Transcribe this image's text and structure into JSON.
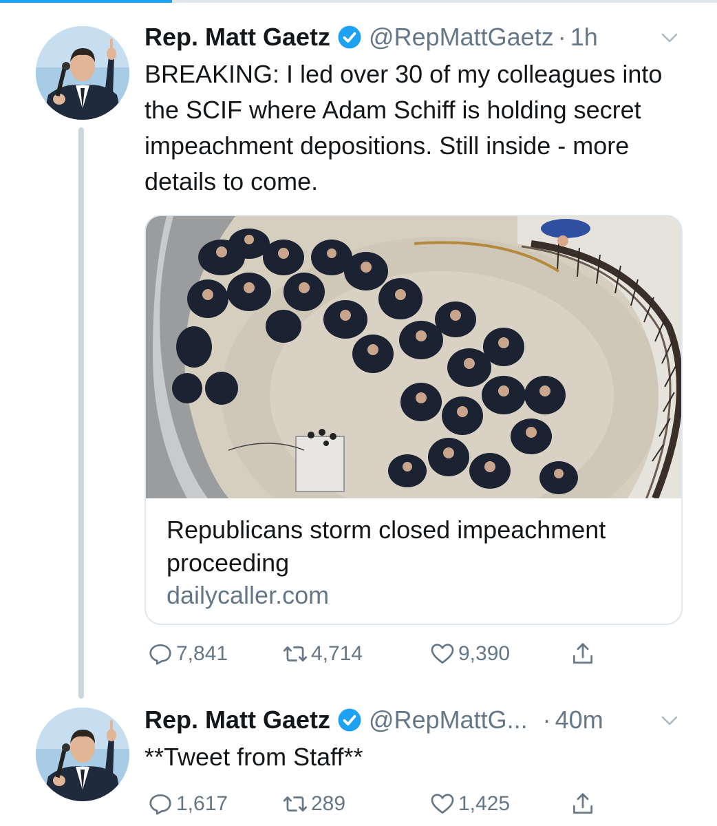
{
  "tweets": [
    {
      "name": "Rep. Matt Gaetz",
      "handle": "@RepMattGaetz",
      "separator": "·",
      "time": "1h",
      "text": "BREAKING: I led over 30 of my colleagues into the SCIF where Adam Schiff is holding secret impeachment depositions. Still inside - more details to come.",
      "card": {
        "title": "Republicans storm closed impeachment proceeding",
        "domain": "dailycaller.com"
      },
      "replies": "7,841",
      "retweets": "4,714",
      "likes": "9,390"
    },
    {
      "name": "Rep. Matt Gaetz",
      "handle": "@RepMattG...",
      "separator": "·",
      "time": "40m",
      "text": "**Tweet from Staff**",
      "replies": "1,617",
      "retweets": "289",
      "likes": "1,425"
    }
  ],
  "icons": {
    "verified": "verified-badge-icon",
    "menu": "chevron-down-icon",
    "reply": "reply-icon",
    "retweet": "retweet-icon",
    "like": "heart-icon",
    "share": "share-icon"
  },
  "colors": {
    "accent": "#1da1f2",
    "muted": "#657786",
    "text": "#14171a",
    "border": "#e1e8ed",
    "thread_line": "#ccd6dd"
  }
}
